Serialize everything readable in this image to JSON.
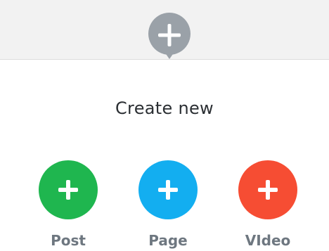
{
  "header": {
    "add_icon": "plus-icon"
  },
  "dialog": {
    "title": "Create new",
    "options": [
      {
        "label": "Post",
        "color": "#1fb64f",
        "icon": "plus-icon"
      },
      {
        "label": "Page",
        "color": "#13aef0",
        "icon": "plus-icon"
      },
      {
        "label": "VIdeo",
        "color": "#f64d33",
        "icon": "plus-icon"
      }
    ]
  },
  "colors": {
    "header_background": "#f2f2f2",
    "header_add_button": "#9aa1a8",
    "title_text": "#2b2f33",
    "option_label_text": "#6e7780"
  }
}
